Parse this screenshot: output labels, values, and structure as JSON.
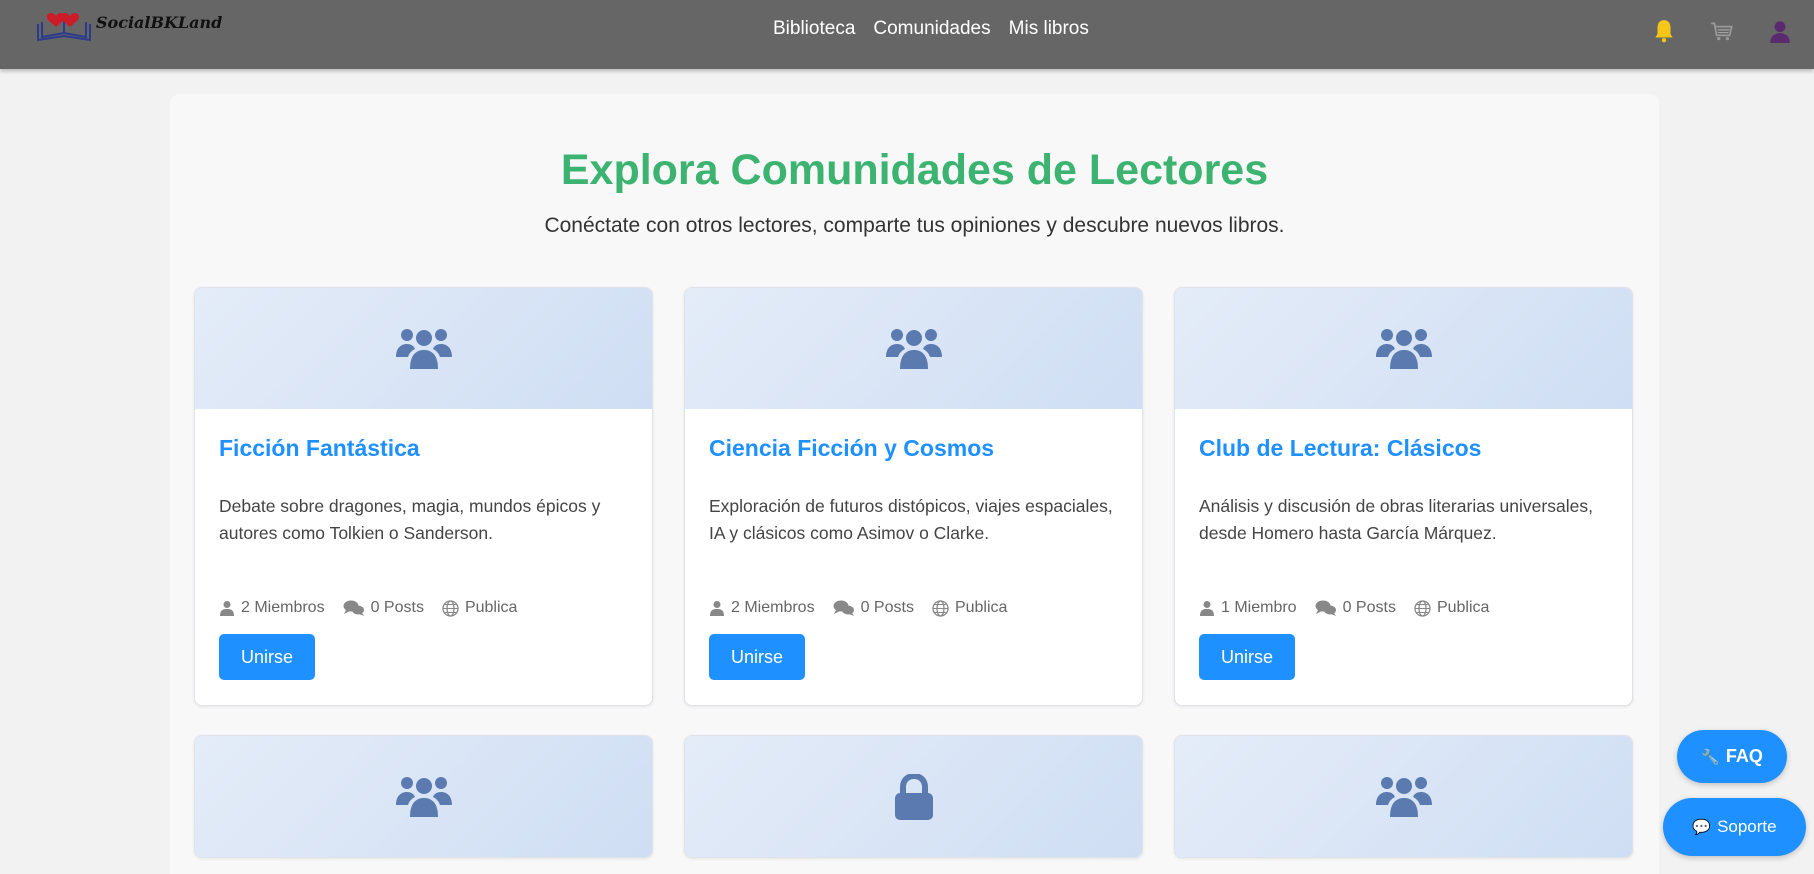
{
  "brand": {
    "name": "SocialBKLand"
  },
  "nav": {
    "links": [
      "Biblioteca",
      "Comunidades",
      "Mis libros"
    ],
    "icons": [
      "bell-icon",
      "cart-icon",
      "user-icon"
    ]
  },
  "page": {
    "title": "Explora Comunidades de Lectores",
    "subtitle": "Conéctate con otros lectores, comparte tus opiniones y descubre nuevos libros."
  },
  "communities": [
    {
      "icon": "users-icon",
      "name": "Ficción Fantástica",
      "description": "Debate sobre dragones, magia, mundos épicos y autores como Tolkien o Sanderson.",
      "members": "2 Miembros",
      "posts": "0 Posts",
      "visibility": "Publica",
      "action": "Unirse"
    },
    {
      "icon": "users-icon",
      "name": "Ciencia Ficción y Cosmos",
      "description": "Exploración de futuros distópicos, viajes espaciales, IA y clásicos como Asimov o Clarke.",
      "members": "2 Miembros",
      "posts": "0 Posts",
      "visibility": "Publica",
      "action": "Unirse"
    },
    {
      "icon": "users-icon",
      "name": "Club de Lectura: Clásicos",
      "description": "Análisis y discusión de obras literarias universales, desde Homero hasta García Márquez.",
      "members": "1 Miembro",
      "posts": "0 Posts",
      "visibility": "Publica",
      "action": "Unirse"
    },
    {
      "icon": "users-icon"
    },
    {
      "icon": "lock-icon"
    },
    {
      "icon": "users-icon"
    }
  ],
  "floating": {
    "faq": "FAQ",
    "support": "Soporte"
  },
  "colors": {
    "navbar": "#666666",
    "accent_green": "#3cb371",
    "accent_blue": "#1e90ff",
    "bell": "#f5c518",
    "avatar": "#5a2a6e"
  }
}
